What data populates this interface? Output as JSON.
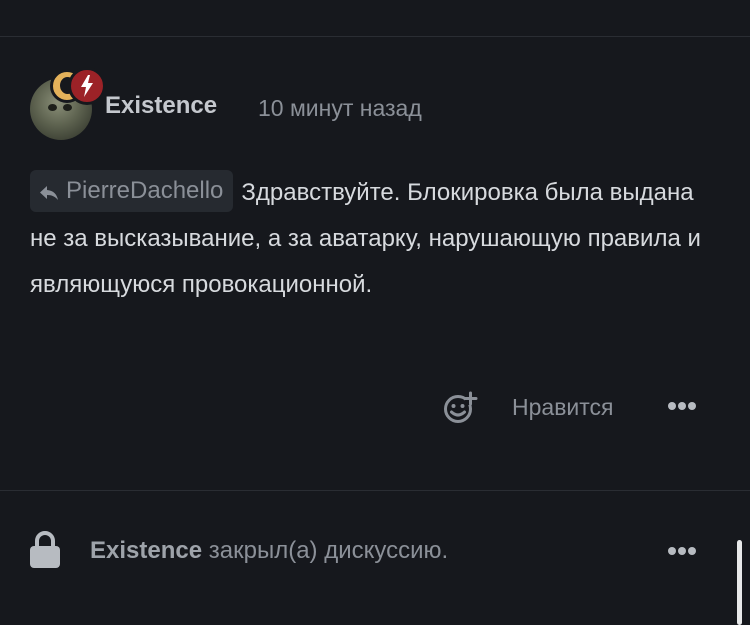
{
  "comment": {
    "author": "Existence",
    "timestamp": "10 минут назад",
    "reply_to": "PierreDachello",
    "text": "Здравствуйте. Блокировка была выдана не за высказывание, а за аватарку, нарушающую правила и являющуюся провокационной.",
    "badge_icon": "lightning-icon",
    "actions": {
      "react_icon": "add-reaction-icon",
      "like_label": "Нравится",
      "more_icon": "ellipsis-icon"
    }
  },
  "event": {
    "icon": "lock-icon",
    "actor": "Existence",
    "action_text": "закрыл(а) дискуссию."
  },
  "colors": {
    "background": "#16181d",
    "badge_red": "#9c2227",
    "badge_gold": "#e3b15a",
    "muted_text": "#8b9098",
    "body_text": "#d7dade"
  }
}
